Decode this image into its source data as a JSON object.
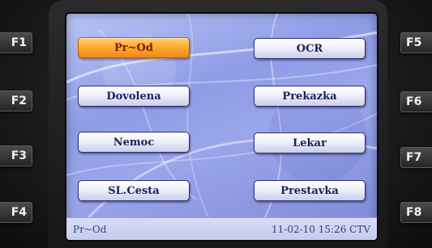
{
  "function_keys": {
    "left": [
      {
        "label": "F1"
      },
      {
        "label": "F2"
      },
      {
        "label": "F3"
      },
      {
        "label": "F4"
      }
    ],
    "right": [
      {
        "label": "F5"
      },
      {
        "label": "F6"
      },
      {
        "label": "F7"
      },
      {
        "label": "F8"
      }
    ]
  },
  "menu": {
    "buttons": [
      {
        "label": "Pr~Od",
        "selected": true
      },
      {
        "label": "OCR"
      },
      {
        "label": "Dovolena"
      },
      {
        "label": "Prekazka"
      },
      {
        "label": "Nemoc"
      },
      {
        "label": "Lekar"
      },
      {
        "label": "SL.Cesta"
      },
      {
        "label": "Prestavka"
      }
    ]
  },
  "status_bar": {
    "mode": "Pr~Od",
    "datetime": "11-02-10 15:26 CTV"
  },
  "colors": {
    "selected_button": "#ffab2e",
    "button": "#eef0fb",
    "screen_bg": "#9aa6ea"
  }
}
